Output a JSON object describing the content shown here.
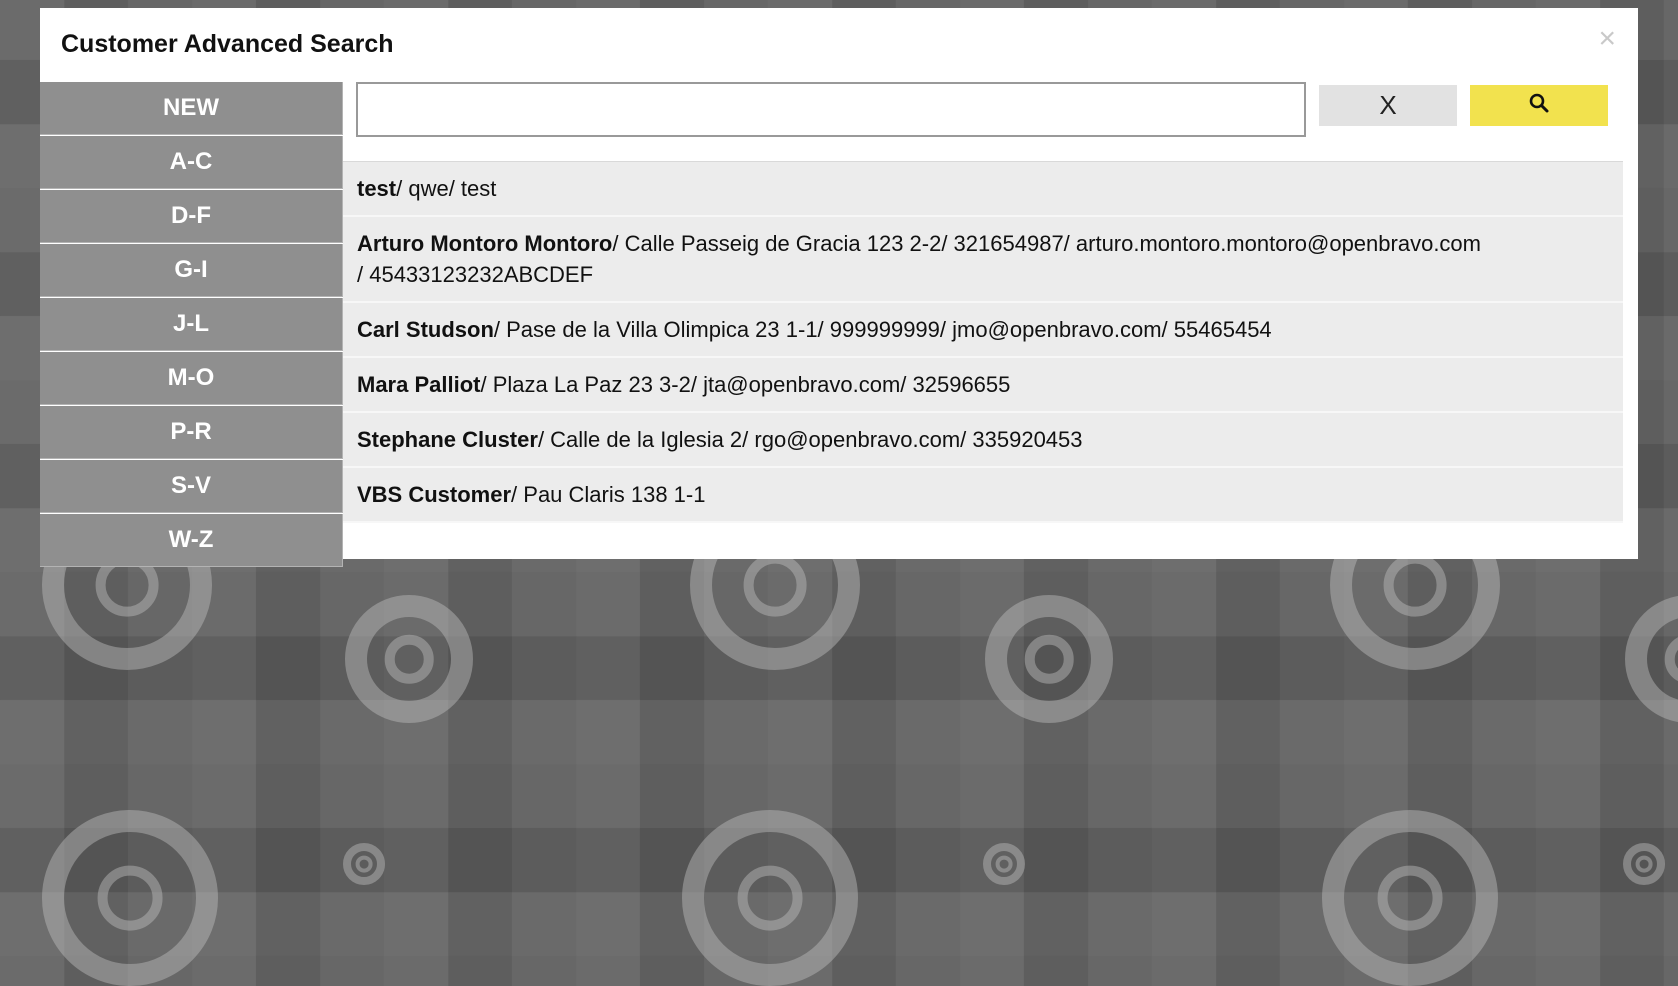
{
  "modal": {
    "title": "Customer Advanced Search",
    "close_glyph": "×"
  },
  "sidebar": {
    "items": [
      "NEW",
      "A-C",
      "D-F",
      "G-I",
      "J-L",
      "M-O",
      "P-R",
      "S-V",
      "W-Z"
    ]
  },
  "search": {
    "value": "",
    "placeholder": "",
    "clear_label": "X",
    "search_icon": "search-icon"
  },
  "results": [
    {
      "name": "test",
      "details": "/ qwe/ test"
    },
    {
      "name": "Arturo Montoro Montoro",
      "details": "/ Calle Passeig de Gracia 123 2-2/ 321654987/ arturo.montoro.montoro@openbravo.com",
      "details2": "/ 45433123232ABCDEF"
    },
    {
      "name": "Carl Studson",
      "details": "/ Pase de la Villa Olimpica 23 1-1/ 999999999/ jmo@openbravo.com/ 55465454"
    },
    {
      "name": "Mara Palliot",
      "details": "/ Plaza La Paz 23 3-2/ jta@openbravo.com/ 32596655"
    },
    {
      "name": "Stephane Cluster",
      "details": "/ Calle de la Iglesia 2/ rgo@openbravo.com/ 335920453"
    },
    {
      "name": "VBS Customer",
      "details": "/ Pau Claris 138 1-1"
    }
  ],
  "colors": {
    "search_button": "#f2e24e",
    "sidebar_item": "#8f8f8f",
    "result_row": "#ececec"
  }
}
